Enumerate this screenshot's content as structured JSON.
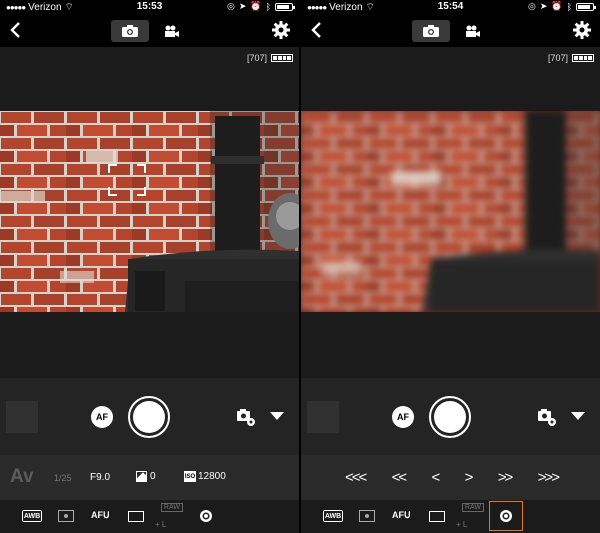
{
  "left": {
    "status": {
      "carrier": "Verizon",
      "time": "15:53"
    },
    "shots_remaining": "[707]",
    "controls": {
      "af_label": "AF"
    },
    "exposure": {
      "mode": "Av",
      "shutter": "1/25",
      "aperture": "F9.0",
      "exposure_comp": "0",
      "iso": "12800"
    },
    "bottom": {
      "awb_label": "AWB",
      "af_mode_label": "AF",
      "raw_label": "RAW",
      "quality_label": "+ L"
    }
  },
  "right": {
    "status": {
      "carrier": "Verizon",
      "time": "15:54"
    },
    "shots_remaining": "[707]",
    "controls": {
      "af_label": "AF"
    },
    "focus_nav": [
      "<<<",
      "<<",
      "<",
      ">",
      ">>",
      ">>>"
    ],
    "bottom": {
      "awb_label": "AWB",
      "af_mode_label": "AF",
      "raw_label": "RAW",
      "quality_label": "+ L"
    }
  },
  "iso_icon_label": "ISO",
  "colors": {
    "accent": "#e07a1e",
    "brick": "#b3452e",
    "mortar": "#d7d2c9"
  }
}
